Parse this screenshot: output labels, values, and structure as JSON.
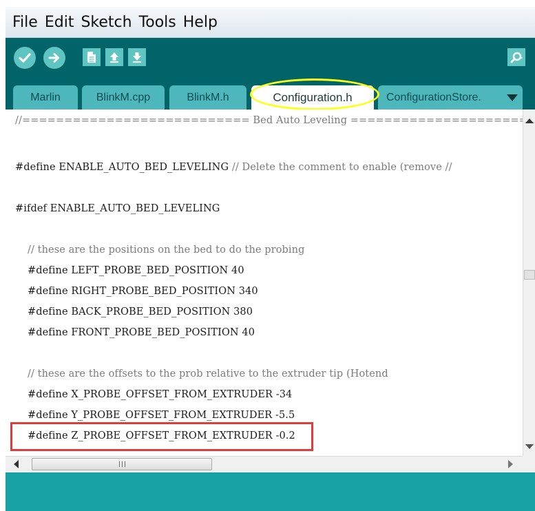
{
  "menubar": {
    "items": [
      "File",
      "Edit",
      "Sketch",
      "Tools",
      "Help"
    ]
  },
  "toolbar": {
    "buttons": [
      "verify-icon",
      "upload-icon",
      "new-icon",
      "open-icon",
      "save-icon",
      "serial-monitor-icon"
    ]
  },
  "tabs": [
    {
      "label": "Marlin"
    },
    {
      "label": "BlinkM.cpp"
    },
    {
      "label": "BlinkM.h"
    },
    {
      "label": "Configuration.h"
    },
    {
      "label": "ConfigurationStore."
    }
  ],
  "active_tab": "Configuration.h",
  "editor": {
    "lines": [
      "//=========================== Bed Auto Leveling ===========================",
      "#define ENABLE_AUTO_BED_LEVELING // Delete the comment to enable (remove //",
      "#ifdef ENABLE_AUTO_BED_LEVELING",
      "// these are the positions on the bed to do the probing",
      "#define LEFT_PROBE_BED_POSITION 40",
      "#define RIGHT_PROBE_BED_POSITION 340",
      "#define BACK_PROBE_BED_POSITION 380",
      "#define FRONT_PROBE_BED_POSITION 40",
      "// these are the offsets to the prob relative to the extruder tip (Hotend",
      "#define X_PROBE_OFFSET_FROM_EXTRUDER -34",
      "#define Y_PROBE_OFFSET_FROM_EXTRUDER -5.5",
      "#define Z_PROBE_OFFSET_FROM_EXTRUDER -0.2"
    ],
    "define_comment": "// Delete the comment to enable (remove //"
  },
  "colors": {
    "toolbar_bg": "#006468",
    "tab_bg": "#4db7bb",
    "console_bg": "#17a1a5",
    "ellipse_highlight": "#ffff14",
    "box_highlight": "#e23b3b"
  }
}
